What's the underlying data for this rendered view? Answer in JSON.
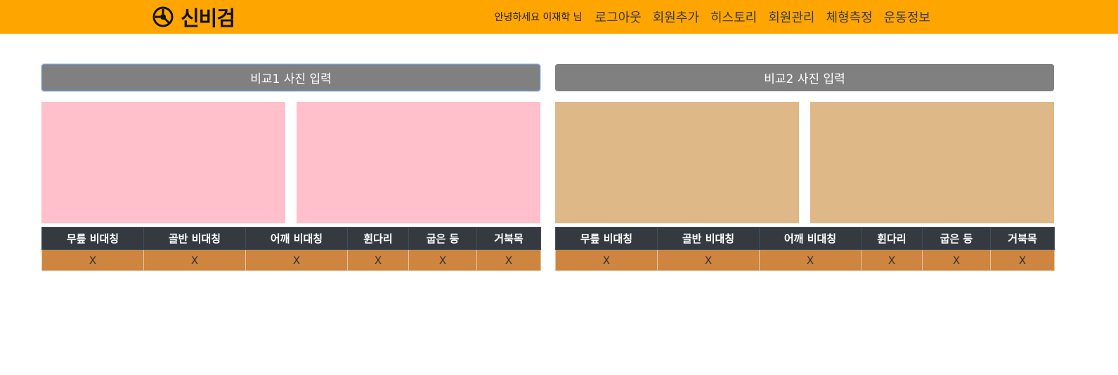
{
  "header": {
    "brand": "신비검",
    "greeting": "안녕하세요 이재학 님",
    "nav": [
      "로그아웃",
      "회원추가",
      "히스토리",
      "회원관리",
      "체형측정",
      "운동정보"
    ],
    "colors": {
      "background": "#ffa500"
    }
  },
  "panels": [
    {
      "button_label": "비교1 사진 입력",
      "photo_color": "#ffc0cb",
      "columns": [
        "무릎 비대칭",
        "골반 비대칭",
        "어깨 비대칭",
        "휜다리",
        "굽은 등",
        "거북목"
      ],
      "values": [
        "X",
        "X",
        "X",
        "X",
        "X",
        "X"
      ]
    },
    {
      "button_label": "비교2 사진 입력",
      "photo_color": "#deb887",
      "columns": [
        "무릎 비대칭",
        "골반 비대칭",
        "어깨 비대칭",
        "휜다리",
        "굽은 등",
        "거북목"
      ],
      "values": [
        "X",
        "X",
        "X",
        "X",
        "X",
        "X"
      ]
    }
  ],
  "colors": {
    "table_header": "#343a40",
    "table_cell": "#cd853f",
    "button": "#808080"
  }
}
